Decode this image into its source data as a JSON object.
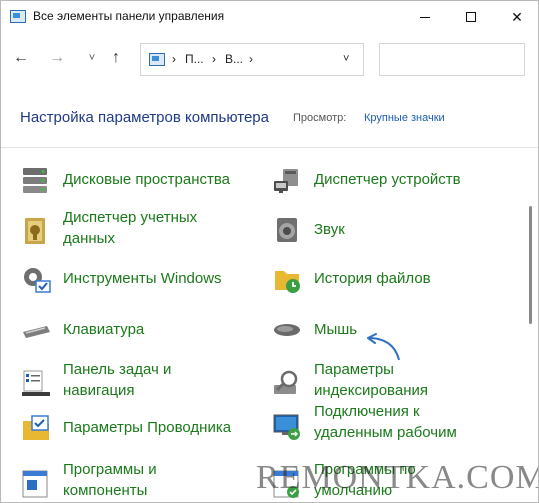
{
  "window": {
    "title": "Все элементы панели управления",
    "controls": {
      "minimize": "minimize-icon",
      "maximize": "maximize-icon",
      "close": "✕"
    }
  },
  "navigation": {
    "back": "←",
    "forward": "→",
    "recent": "˅",
    "up": "↑",
    "address_segments": [
      "П...",
      "В..."
    ],
    "separator": "›",
    "dropdown": "˅",
    "search_placeholder": ""
  },
  "header": {
    "title": "Настройка параметров компьютера",
    "view_label": "Просмотр:",
    "view_value": "Крупные значки"
  },
  "items": [
    {
      "label": "Дисковые пространства",
      "icon": "storage-spaces-icon"
    },
    {
      "label": "Диспетчер устройств",
      "icon": "device-manager-icon"
    },
    {
      "label": "Диспетчер учетных\nданных",
      "icon": "credential-manager-icon"
    },
    {
      "label": "Звук",
      "icon": "sound-icon"
    },
    {
      "label": "Инструменты Windows",
      "icon": "windows-tools-icon"
    },
    {
      "label": "История файлов",
      "icon": "file-history-icon"
    },
    {
      "label": "Клавиатура",
      "icon": "keyboard-icon"
    },
    {
      "label": "Мышь",
      "icon": "mouse-icon"
    },
    {
      "label": "Панель задач и\nнавигация",
      "icon": "taskbar-icon"
    },
    {
      "label": "Параметры\nиндексирования",
      "icon": "indexing-icon"
    },
    {
      "label": "Параметры Проводника",
      "icon": "explorer-options-icon"
    },
    {
      "label": "Подключения к\nудаленным рабочим",
      "icon": "remote-desktop-icon"
    },
    {
      "label": "Программы и\nкомпоненты",
      "icon": "programs-icon"
    },
    {
      "label": "Программы по\nумолчанию",
      "icon": "default-programs-icon"
    }
  ],
  "colors": {
    "link_green": "#1b7a1b",
    "header_blue": "#1e3a8a",
    "view_link": "#1f5fb0",
    "annotation_arrow": "#2f6fc4"
  },
  "watermark": "REMONTKA.COM"
}
